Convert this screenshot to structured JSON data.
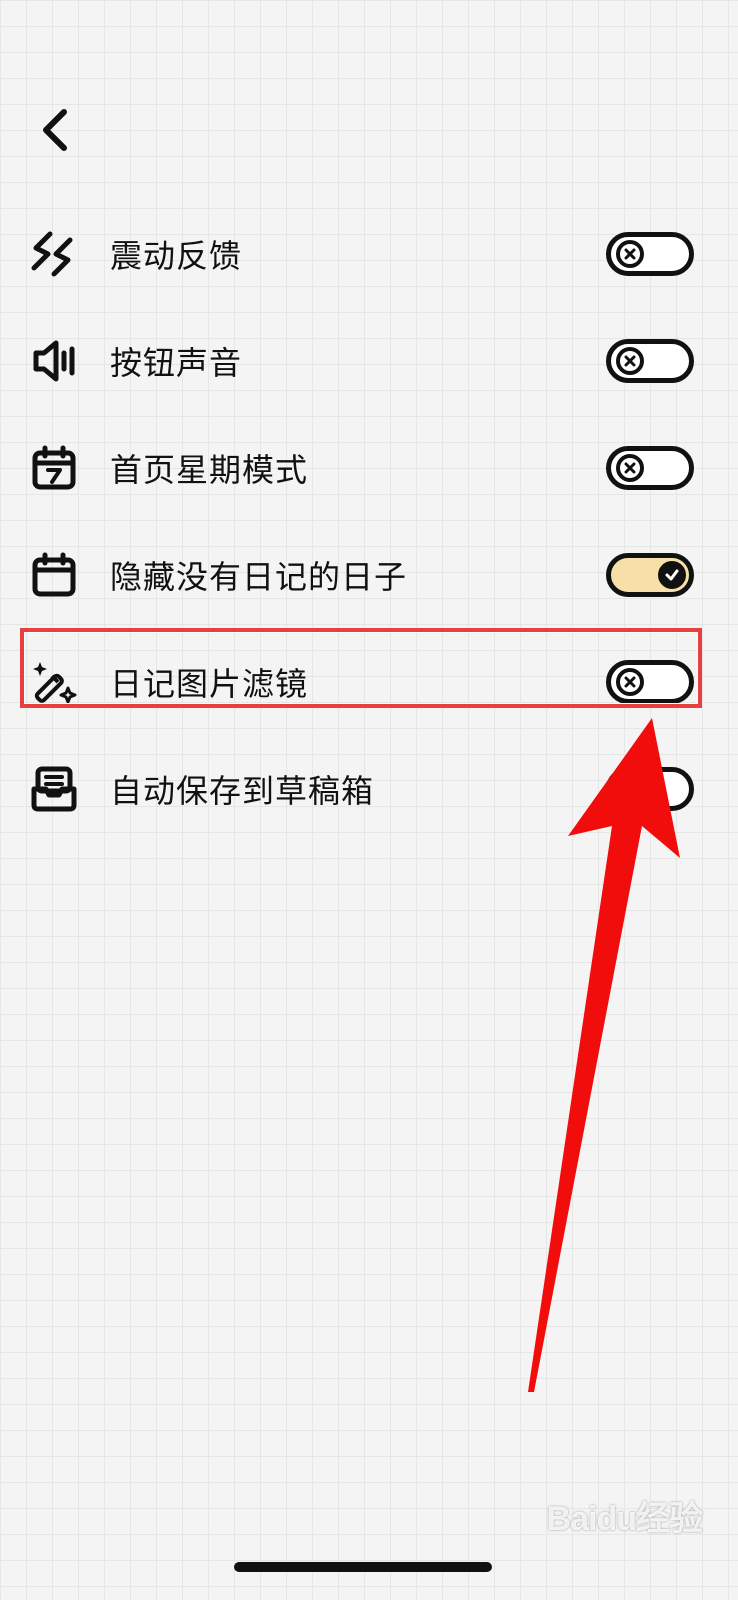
{
  "header": {
    "back_icon": "chevron-left-icon"
  },
  "settings": [
    {
      "label": "震动反馈",
      "icon": "vibration-icon",
      "enabled": false
    },
    {
      "label": "按钮声音",
      "icon": "speaker-icon",
      "enabled": false
    },
    {
      "label": "首页星期模式",
      "icon": "calendar-week-icon",
      "enabled": false
    },
    {
      "label": "隐藏没有日记的日子",
      "icon": "calendar-icon",
      "enabled": true
    },
    {
      "label": "日记图片滤镜",
      "icon": "magic-wand-icon",
      "enabled": false
    },
    {
      "label": "自动保存到草稿箱",
      "icon": "inbox-icon",
      "enabled": false
    }
  ],
  "colors": {
    "toggle_on": "#f7dfa8",
    "highlight": "#e8403f",
    "arrow": "#f20d0d"
  },
  "watermark": "Baidu经验"
}
